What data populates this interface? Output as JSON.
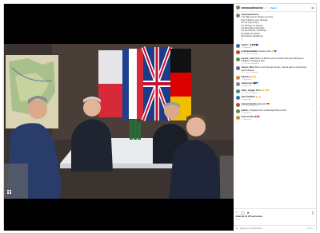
{
  "post": {
    "username": "emmanuelmacron",
    "verified_icon": "verified-badge-icon",
    "separator": "•",
    "follow_label": "Suivi",
    "more_icon": "more-options-icon"
  },
  "caption": {
    "username": "emmanuelmacron",
    "lines": [
      "À la table pour le Ukraine aux Kyiv.",
      "Pour l'Ukraine, pour l'Europe.",
      "",
      "On our way to Kyiv.",
      "For Ukraine, for Europe.",
      "",
      "Auf dem Weg nach Kyjiw.",
      "Für die Ukraine, für Europa.",
      "",
      "W drodze do Kijowa.",
      "Dla Ukrainy, dla Europy."
    ],
    "meta": "1 j"
  },
  "comments": [
    {
      "user": "ateliers_",
      "text": "🇫🇷🇺🇦🇪🇺",
      "meta": "1 j   Répondre",
      "avatar": "av-blue"
    },
    {
      "user": "pointhumanitaire",
      "text": "Soutien unité 💛💙",
      "meta": "1 j   3 J'aime   Répondre",
      "avatar": "av-red"
    },
    {
      "user": "europe_voice",
      "text": "Merci, la France est au rendez-vous pour l'Europe et l'Ukraine. Courage à tous.",
      "meta": "1 j   12 J'aime   Répondre",
      "avatar": "av-green"
    },
    {
      "user": "citoyen_libre",
      "text": "Rien ne se fera sans la paix, mais la paix ne se fera pas sans l'Ukraine.",
      "meta": "1 j   5 J'aime   Répondre",
      "avatar": "av-purple"
    },
    {
      "user": "lalenna.p",
      "text": "👏👏",
      "meta": "1 j   Répondre",
      "avatar": "av-orange"
    },
    {
      "user": "samuel.dev",
      "text": "🇪🇺🇺🇦",
      "meta": "1 j   Répondre",
      "avatar": "av-grey"
    },
    {
      "user": "marie_voyage",
      "text": "Bravo 👏👏👏",
      "meta": "1 j   2 J'aime   Répondre",
      "avatar": "av-teal"
    },
    {
      "user": "pierre.lambert",
      "text": "💪💪",
      "meta": "1 j   Répondre",
      "avatar": "av-blue"
    },
    {
      "user": "anna.kovalenko",
      "text": "Дякуємо! 🇺🇦",
      "meta": "1 j   4 J'aime   Répondre",
      "avatar": "av-red"
    },
    {
      "user": "jeanne_d",
      "text": "Agissez pour une Europe forte et unie !",
      "meta": "1 j   Répondre",
      "avatar": "av-green"
    },
    {
      "user": "lucas.europe",
      "text": "🇫🇷❤️",
      "meta": "1 j   Répondre",
      "avatar": "av-orange"
    }
  ],
  "actions": {
    "like_icon": "heart-icon",
    "comment_icon": "comment-icon",
    "share_icon": "share-icon",
    "save_icon": "bookmark-icon",
    "likes": "Aimé par 31 273 personnes",
    "date": "1 jour"
  },
  "add_comment": {
    "placeholder": "Ajouter un commentaire...",
    "post_label": "Publier"
  },
  "media": {
    "alt": "Leaders seated at a meeting table with flags",
    "carousel_icon": "carousel-grid-icon"
  }
}
